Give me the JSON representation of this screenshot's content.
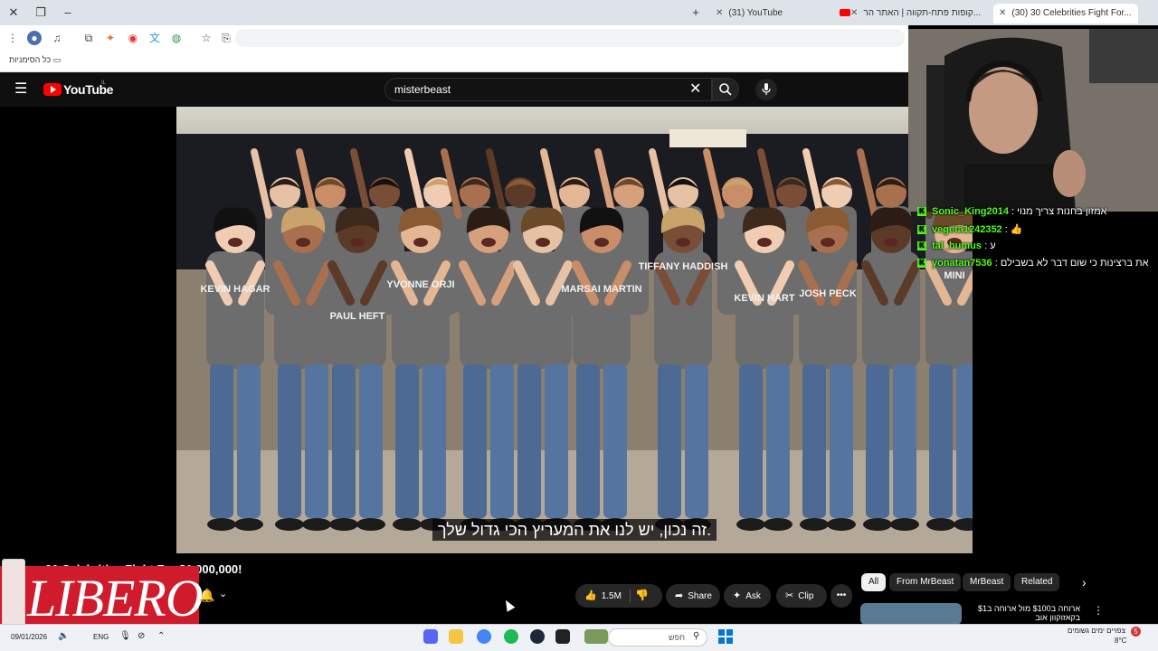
{
  "browser": {
    "tabs": [
      {
        "label": "(31) YouTube",
        "active": false
      },
      {
        "label": "קופות פתח-תקווה | האתר הר...",
        "active": false
      },
      {
        "label": "(30) 30 Celebrities Fight For...",
        "active": true
      }
    ],
    "bookmarks_label": "כל הסימניות"
  },
  "youtube": {
    "logo_text": "YouTube",
    "logo_region": "IL",
    "search_value": "misterbeast",
    "video_title": "30 Celebrities Fight For $1,000,000!",
    "subtitle": "זה נכון, יש לנו את המעריץ הכי גדול שלך.",
    "shirt_names": [
      "KEVIN HAGAR",
      "PAUL HEFT",
      "YVONNE ORJI",
      "MARSAI MARTIN",
      "TIFFANY HADDISH",
      "KEVIN HART",
      "JOSH PECK",
      "MINI"
    ],
    "actions": {
      "like_count": "1.5M",
      "share": "Share",
      "ask": "Ask",
      "clip": "Clip"
    },
    "chips": [
      "All",
      "From MrBeast",
      "MrBeast",
      "Related"
    ],
    "recommended": {
      "title": "ארוחה ב$100 מול ארוחה ב$1 בקאזוקוון אוב"
    }
  },
  "stream_chat": [
    {
      "user": "Sonic_King2014",
      "message": "אמזון בחנות צריך מנוי"
    },
    {
      "user": "vegeta1242352",
      "message": "👍"
    },
    {
      "user": "tal_humus",
      "message": "ע"
    },
    {
      "user": "yonatan7536",
      "message": "את ברצינות כי שום דבר לא בשבילם"
    }
  ],
  "ad_overlay": {
    "brand": "LIBERO"
  },
  "taskbar": {
    "date": "09/01/2026",
    "lang": "ENG",
    "search_placeholder": "חפש",
    "weather_label": "צפויים ימים גשומים",
    "temperature": "8°C",
    "notification_count": "5"
  },
  "colors": {
    "youtube_red": "#ff0000",
    "kick_green": "#53fc18",
    "libero_red": "#cf1b2b",
    "shirt_gray": "#6d6d6d"
  }
}
